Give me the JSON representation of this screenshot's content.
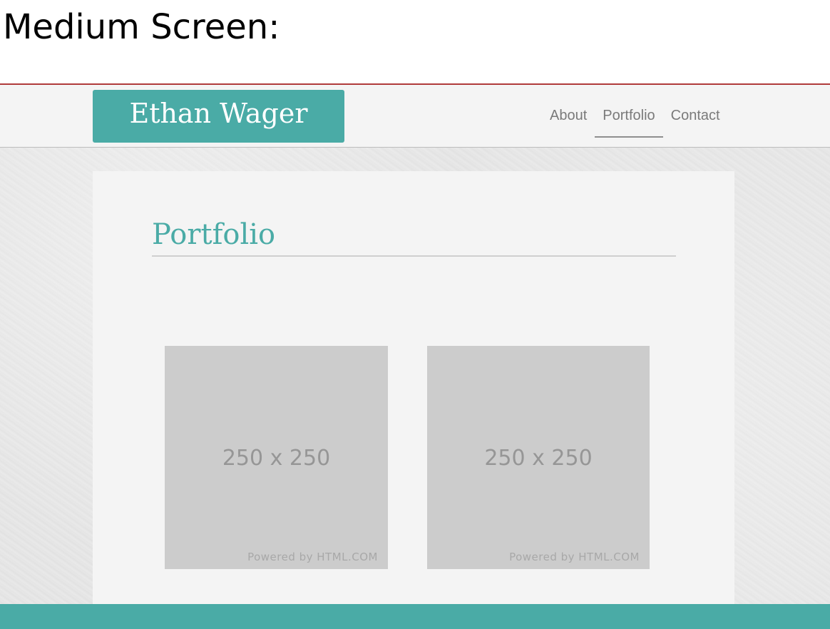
{
  "slide": {
    "title": "Medium Screen:"
  },
  "header": {
    "brand": "Ethan Wager",
    "nav": [
      {
        "label": "About",
        "active": false
      },
      {
        "label": "Portfolio",
        "active": true
      },
      {
        "label": "Contact",
        "active": false
      }
    ]
  },
  "main": {
    "section_title": "Portfolio",
    "thumbnails": [
      {
        "size_label": "250 x 250",
        "powered_by": "Powered by HTML.COM"
      },
      {
        "size_label": "250 x 250",
        "powered_by": "Powered by HTML.COM"
      }
    ]
  },
  "colors": {
    "accent": "#4aaba6",
    "divider_red": "#b03a3a",
    "placeholder_gray": "#cccccc"
  }
}
